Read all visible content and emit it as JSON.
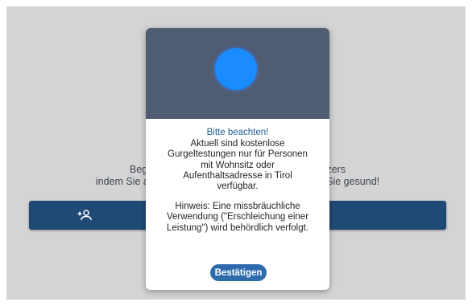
{
  "background": {
    "intro_lines": [
      "Beginnen Sie mit der Erstellung eines Benutzers",
      "indem Sie auf „Person hinzufügen“ klicken. Bleiben Sie gesund!"
    ],
    "add_person_icon": "person-add-icon"
  },
  "modal": {
    "logo": "blue-circle-logo",
    "title": "Bitte beachten!",
    "message_lines": [
      "Aktuell sind kostenlose",
      "Gurgeltestungen nur für Personen",
      "mit Wohnsitz oder",
      "Aufenthaltsadresse in Tirol",
      "verfügbar."
    ],
    "hint_lines": [
      "Hinweis: Eine missbräuchliche",
      "Verwendung (\"Erschleichung einer",
      "Leistung\") wird behördlich verfolgt."
    ],
    "confirm_label": "Bestätigen"
  },
  "colors": {
    "overlay": "#d4d4d4",
    "header": "#505c71",
    "logo": "#1a8cff",
    "primary_button": "#204a76",
    "confirm_button": "#2d6bad",
    "title_text": "#245e94"
  }
}
